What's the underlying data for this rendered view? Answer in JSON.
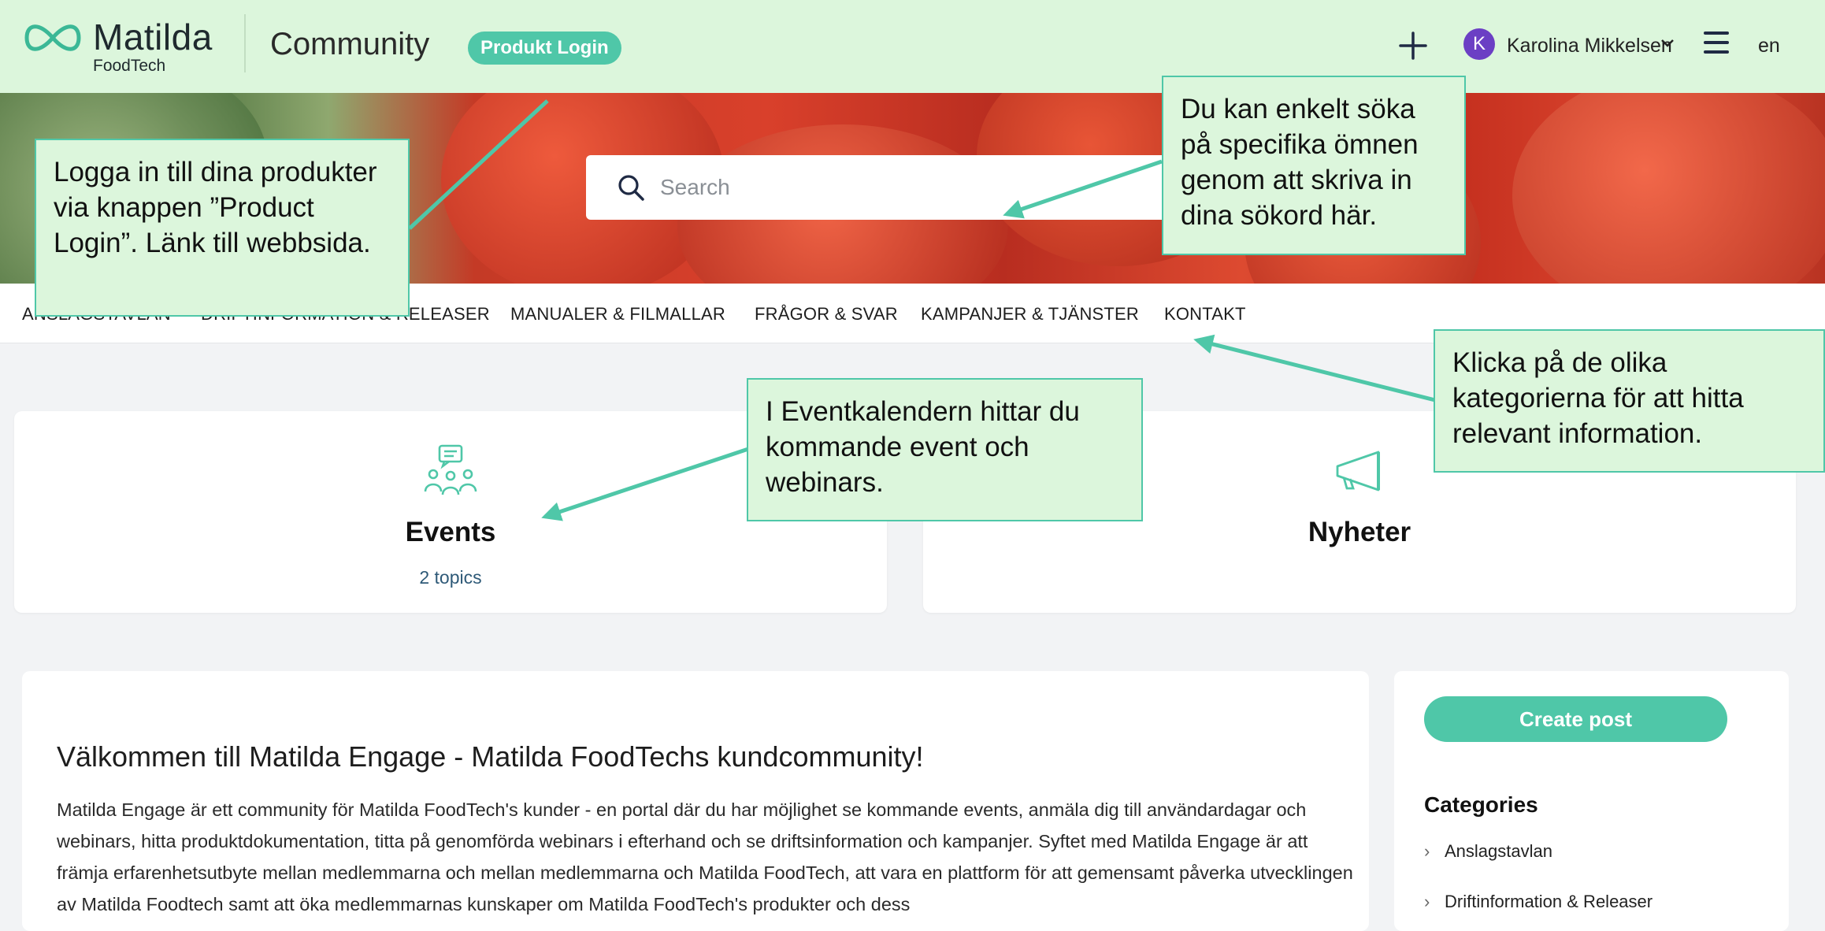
{
  "header": {
    "logo_name": "Matilda",
    "logo_sub": "FoodTech",
    "community": "Community",
    "produkt_login": "Produkt Login",
    "user_initial": "K",
    "user_name": "Karolina Mikkelsen",
    "language": "en",
    "icons": [
      "plus-icon",
      "chevron-down-icon",
      "hamburger-menu-icon"
    ]
  },
  "search": {
    "placeholder": "Search",
    "icon": "search-icon"
  },
  "nav": {
    "items": [
      "ANSLAGSTAVLAN",
      "DRIFTINFORMATION & RELEASER",
      "MANUALER & FILMALLAR",
      "FRÅGOR & SVAR",
      "KAMPANJER & TJÄNSTER",
      "KONTAKT"
    ]
  },
  "tiles": [
    {
      "title": "Events",
      "subtitle": "2 topics",
      "icon": "people-chat-icon"
    },
    {
      "title": "Nyheter",
      "subtitle": "",
      "icon": "megaphone-icon"
    }
  ],
  "main": {
    "title": "Välkommen till Matilda Engage - Matilda FoodTechs kundcommunity!",
    "body": "Matilda Engage är ett community för Matilda FoodTech's kunder - en portal där du har möjlighet se kommande events, anmäla dig till användardagar och webinars, hitta produktdokumentation, titta på genomförda webinars i efterhand och se driftsinformation och kampanjer. Syftet med Matilda Engage är att främja erfarenhetsutbyte mellan medlemmarna och mellan medlemmarna och Matilda FoodTech, att vara en plattform för att gemensamt påverka utvecklingen av Matilda Foodtech samt att öka medlemmarnas kunskaper om Matilda FoodTech's produkter och dess"
  },
  "sidebar": {
    "create_post": "Create post",
    "categories_title": "Categories",
    "categories": [
      "Anslagstavlan",
      "Driftinformation & Releaser"
    ]
  },
  "callouts": {
    "login": "Logga in till dina produkter via knappen ”Product Login”. Länk till webbsida.",
    "search": "Du kan enkelt söka på specifika ömnen genom att skriva in dina sökord här.",
    "events": "I Eventkalendern hittar du kommande event och webinars.",
    "categories": "Klicka på de olika kategorierna för att hitta relevant information."
  },
  "colors": {
    "header_bg": "#dcf6dc",
    "accent": "#4fc7a8",
    "avatar": "#6b3fc4",
    "page_bg": "#f2f3f5"
  }
}
